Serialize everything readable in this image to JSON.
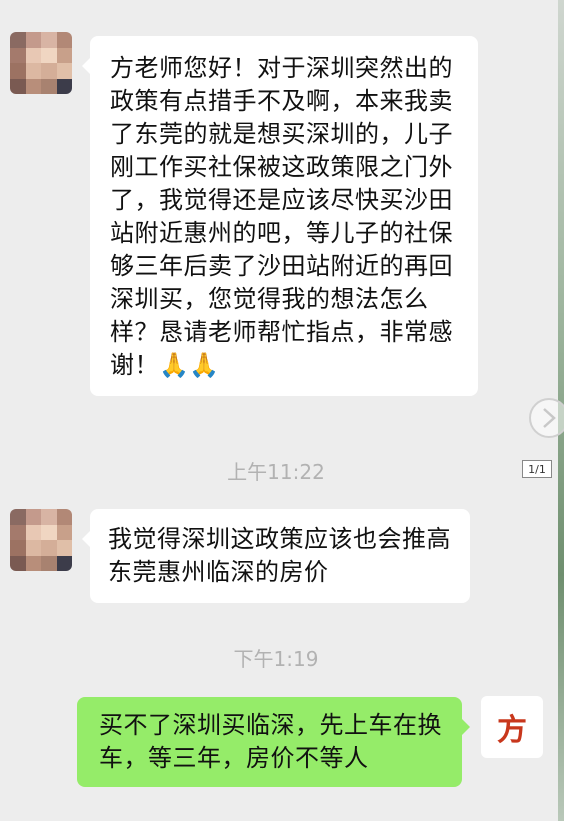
{
  "messages": [
    {
      "sender": "other",
      "text": "方老师您好！对于深圳突然出的政策有点措手不及啊，本来我卖了东莞的就是想买深圳的，儿子刚工作买社保被这政策限之门外了，我觉得还是应该尽快买沙田站附近惠州的吧，等儿子的社保够三年后卖了沙田站附近的再回深圳买，您觉得我的想法怎么样？恳请老师帮忙指点，非常感谢！🙏🙏"
    },
    {
      "sender": "other",
      "text": "我觉得深圳这政策应该也会推高东莞惠州临深的房价"
    },
    {
      "sender": "self",
      "text": "买不了深圳买临深，先上车在换车，等三年，房价不等人"
    }
  ],
  "timestamps": [
    "上午11:22",
    "下午1:19"
  ],
  "self_avatar_char": "方",
  "page_indicator": "1/1",
  "colors": {
    "background": "#ededed",
    "incoming": "#ffffff",
    "outgoing": "#95ec69",
    "timestamp": "#b2b2b2"
  }
}
